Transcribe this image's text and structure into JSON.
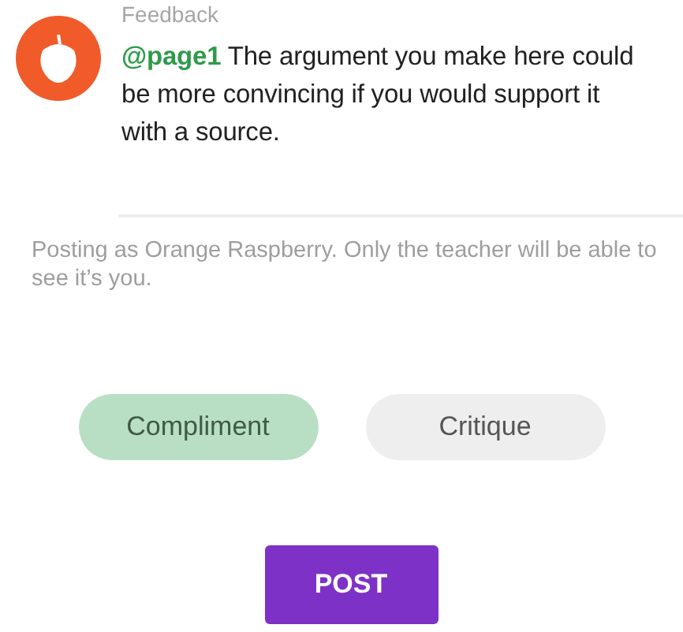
{
  "comment": {
    "label": "Feedback",
    "mention": "@page1",
    "text": " The argument you make here could be more convincing if you would support it with a source."
  },
  "notice": "Posting as Orange Raspberry. Only the teacher will be able to see it’s you.",
  "types": [
    {
      "label": "Compliment",
      "selected": true
    },
    {
      "label": "Critique",
      "selected": false
    }
  ],
  "post_button": "POST"
}
